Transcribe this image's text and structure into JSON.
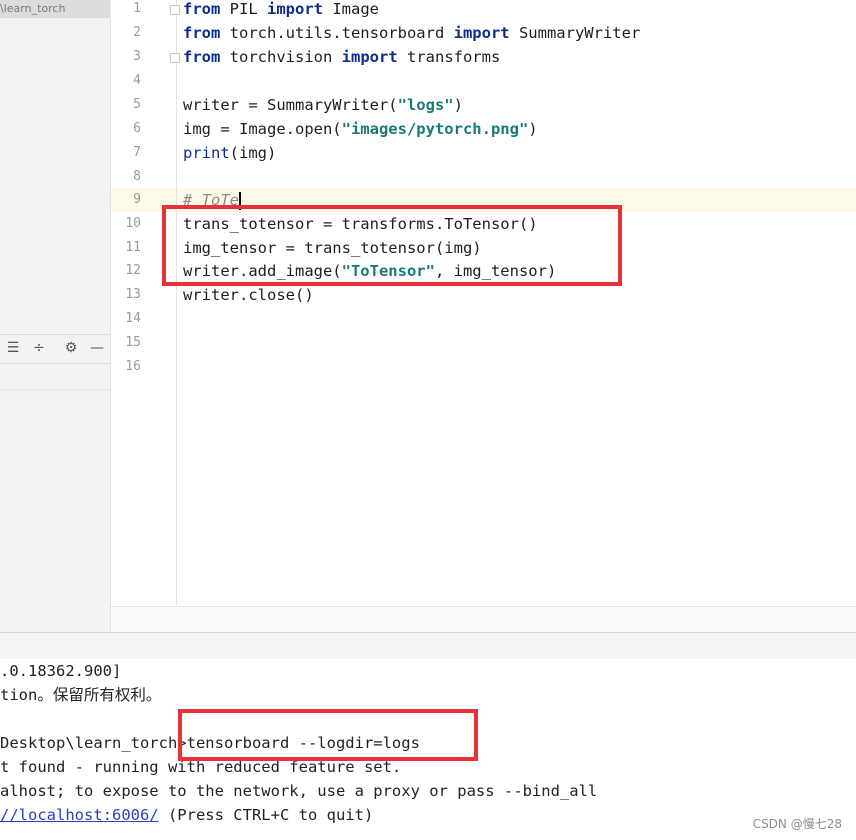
{
  "sidebar": {
    "path_label": "\\learn_torch",
    "toolbar_icons": [
      "align-center-icon",
      "collapse-icon",
      "gear-icon",
      "minimize-icon"
    ]
  },
  "editor": {
    "line_numbers": [
      "1",
      "2",
      "3",
      "4",
      "5",
      "6",
      "7",
      "8",
      "9",
      "10",
      "11",
      "12",
      "13",
      "14",
      "15",
      "16"
    ],
    "lines": {
      "l1": {
        "kw1": "from",
        "t1": " PIL ",
        "kw2": "import",
        "t2": " Image"
      },
      "l2": {
        "kw1": "from",
        "t1": " torch.utils.tensorboard ",
        "kw2": "import",
        "t2": " SummaryWriter"
      },
      "l3": {
        "kw1": "from",
        "t1": " torchvision ",
        "kw2": "import",
        "t2": " transforms"
      },
      "l5": {
        "t1": "writer = SummaryWriter(",
        "s1": "\"logs\"",
        "t2": ")"
      },
      "l6": {
        "t1": "img = Image.open(",
        "s1": "\"images/pytorch.png\"",
        "t2": ")"
      },
      "l7": {
        "f1": "print",
        "t1": "(img)"
      },
      "l9": {
        "c1": "# ToTe"
      },
      "l10": {
        "t1": "trans_totensor = transforms.ToTensor()"
      },
      "l11": {
        "t1": "img_tensor = trans_totensor(img)"
      },
      "l12": {
        "t1": "writer.add_image(",
        "s1": "\"ToTensor\"",
        "t2": ", img_tensor)"
      },
      "l13": {
        "t1": "writer.close()"
      }
    }
  },
  "terminal": {
    "lines": [
      ".0.18362.900]",
      "tion。保留所有权利。",
      "",
      "Desktop\\learn_torch>tensorboard --logdir=logs",
      "t found - running with reduced feature set.",
      "alhost; to expose to the network, use a proxy or pass --bind_all"
    ],
    "url_line": {
      "url": "//localhost:6006/",
      "rest": " (Press CTRL+C to quit)"
    }
  },
  "annotation_color": "#e8303a",
  "watermark": "CSDN @慢七28"
}
